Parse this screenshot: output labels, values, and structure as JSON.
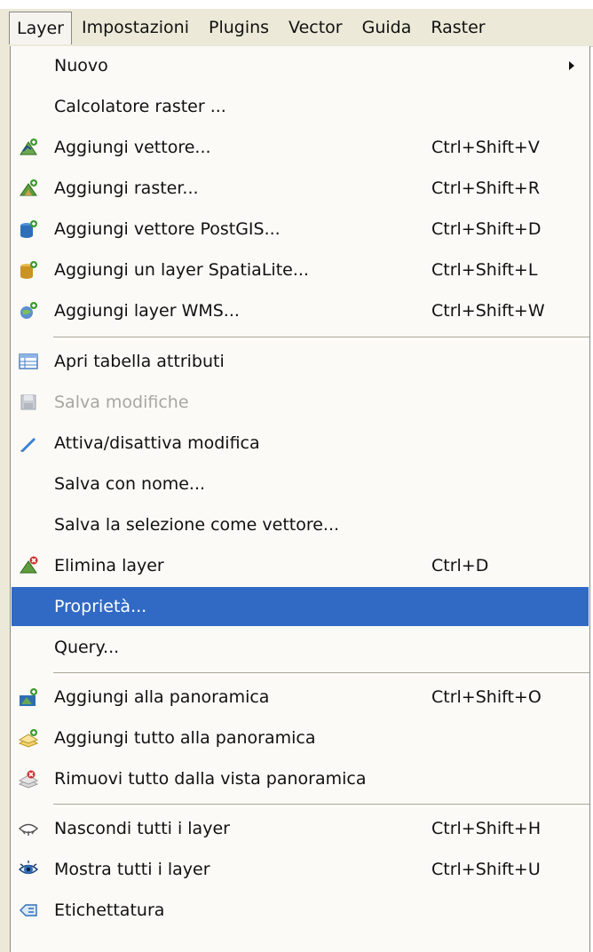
{
  "menubar": {
    "items": [
      "Layer",
      "Impostazioni",
      "Plugins",
      "Vector",
      "Guida",
      "Raster"
    ]
  },
  "menu": {
    "items": [
      {
        "label": "Nuovo",
        "shortcut": "",
        "icon": "",
        "submenu": true
      },
      {
        "label": "Calcolatore raster ...",
        "shortcut": "",
        "icon": ""
      },
      {
        "label": "Aggiungi vettore...",
        "shortcut": "Ctrl+Shift+V",
        "icon": "add-vector-icon"
      },
      {
        "label": "Aggiungi raster...",
        "shortcut": "Ctrl+Shift+R",
        "icon": "add-raster-icon"
      },
      {
        "label": "Aggiungi vettore PostGIS...",
        "shortcut": "Ctrl+Shift+D",
        "icon": "add-postgis-icon"
      },
      {
        "label": "Aggiungi un layer SpatiaLite...",
        "shortcut": "Ctrl+Shift+L",
        "icon": "add-spatialite-icon"
      },
      {
        "label": "Aggiungi layer WMS...",
        "shortcut": "Ctrl+Shift+W",
        "icon": "add-wms-icon"
      },
      {
        "label": "Apri tabella attributi",
        "shortcut": "",
        "icon": "attribute-table-icon"
      },
      {
        "label": "Salva modifiche",
        "shortcut": "",
        "icon": "save-edits-icon",
        "disabled": true
      },
      {
        "label": "Attiva/disattiva modifica",
        "shortcut": "",
        "icon": "toggle-editing-icon"
      },
      {
        "label": "Salva con nome...",
        "shortcut": "",
        "icon": ""
      },
      {
        "label": "Salva la selezione come vettore...",
        "shortcut": "",
        "icon": ""
      },
      {
        "label": "Elimina layer",
        "shortcut": "Ctrl+D",
        "icon": "remove-layer-icon"
      },
      {
        "label": "Proprietà...",
        "shortcut": "",
        "icon": "",
        "selected": true
      },
      {
        "label": "Query...",
        "shortcut": "",
        "icon": ""
      },
      {
        "label": "Aggiungi alla panoramica",
        "shortcut": "Ctrl+Shift+O",
        "icon": "add-overview-icon"
      },
      {
        "label": "Aggiungi tutto alla panoramica",
        "shortcut": "",
        "icon": "add-all-overview-icon"
      },
      {
        "label": "Rimuovi tutto dalla vista panoramica",
        "shortcut": "",
        "icon": "remove-all-overview-icon"
      },
      {
        "label": "Nascondi tutti i layer",
        "shortcut": "Ctrl+Shift+H",
        "icon": "hide-all-icon"
      },
      {
        "label": "Mostra tutti i layer",
        "shortcut": "Ctrl+Shift+U",
        "icon": "show-all-icon"
      },
      {
        "label": "Etichettatura",
        "shortcut": "",
        "icon": "labeling-icon"
      }
    ]
  },
  "colors": {
    "menubar_bg": "#ece9d8",
    "menu_bg": "#fbfaf6",
    "selection": "#316ac5",
    "disabled_text": "#a8a6a0"
  }
}
